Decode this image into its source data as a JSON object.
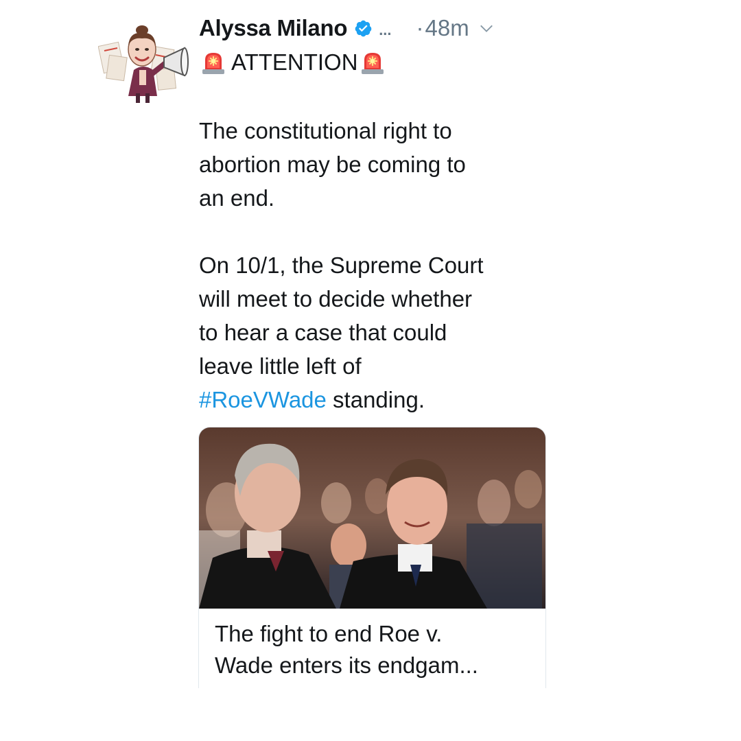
{
  "tweet": {
    "author_name": "Alyssa Milano",
    "more": "...",
    "separator": "·",
    "time": "48m",
    "attention": "ATTENTION",
    "body_lines_1": [
      "The constitutional right to",
      "abortion may be coming to",
      "an end."
    ],
    "body_lines_2": [
      "On 10/1, the Supreme Court",
      "will meet to decide whether",
      "to hear a case that could",
      "leave little left of"
    ],
    "hashtag": "#RoeVWade",
    "hashtag_tail": " standing."
  },
  "card": {
    "title_line_1": "The fight to end Roe v.",
    "title_line_2": "Wade enters its endgam..."
  },
  "icons": {
    "verified": "verified-badge-icon",
    "siren": "police-car-light-icon",
    "chevron": "chevron-down-icon"
  },
  "colors": {
    "hashtag": "#1b95e0",
    "verified": "#1da1f2",
    "muted": "#657786",
    "text": "#14171a"
  }
}
